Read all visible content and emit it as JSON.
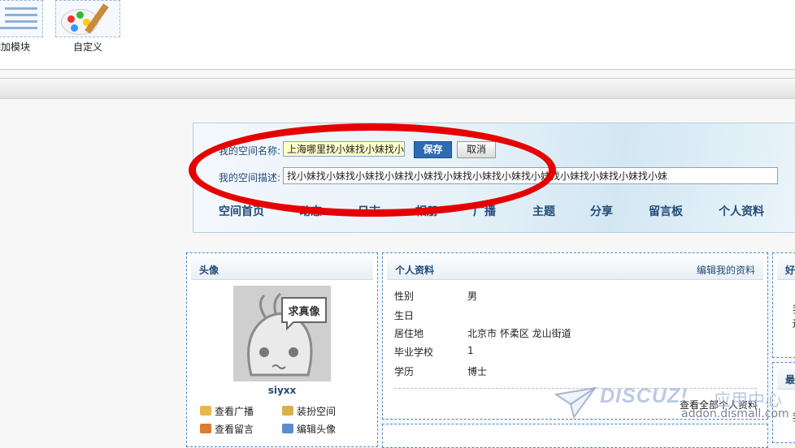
{
  "toolbar": {
    "tools": [
      {
        "label": "添加模块",
        "icon": "add-module-icon"
      },
      {
        "label": "自定义",
        "icon": "palette-icon"
      }
    ]
  },
  "space_header": {
    "name_label": "我的空间名称:",
    "name_value": "上海哪里找小妹找小妹找小",
    "save_label": "保存",
    "cancel_label": "取消",
    "desc_label": "我的空间描述:",
    "desc_value": "找小妹找小妹找小妹找小妹找小妹找小妹找小妹找小妹找小妹找小妹找小妹找小妹找小妹",
    "nav": [
      "空间首页",
      "动态",
      "日志",
      "相册",
      "广播",
      "主题",
      "分享",
      "留言板",
      "个人资料"
    ]
  },
  "avatar_panel": {
    "title": "头像",
    "bubble_text": "求真像",
    "username": "siyxx",
    "links": [
      {
        "label": "查看广播",
        "icon": "megaphone-icon"
      },
      {
        "label": "装扮空间",
        "icon": "wand-icon"
      },
      {
        "label": "查看留言",
        "icon": "pencil-icon"
      },
      {
        "label": "编辑头像",
        "icon": "portrait-icon"
      }
    ]
  },
  "profile_panel": {
    "title": "个人资料",
    "edit_label": "编辑我的资料",
    "rows": [
      {
        "k": "性别",
        "v": "男"
      },
      {
        "k": "生日",
        "v": ""
      },
      {
        "k": "居住地",
        "v": "北京市 怀柔区 龙山街道"
      },
      {
        "k": "毕业学校",
        "v": "1"
      },
      {
        "k": "学历",
        "v": "博士"
      }
    ],
    "view_all": "查看全部个人资料"
  },
  "side_panels": [
    {
      "title": "好",
      "lines": [
        "我",
        "还"
      ]
    },
    {
      "title": "最",
      "lines": [
        "我"
      ]
    }
  ],
  "watermark": {
    "logo": "DISCUZ!",
    "cn": "应用中心",
    "url": "addon.dismall.com"
  },
  "colors": {
    "accent": "#234b7a",
    "highlight_ring": "#e60000",
    "save_button": "#2e6bb3"
  }
}
